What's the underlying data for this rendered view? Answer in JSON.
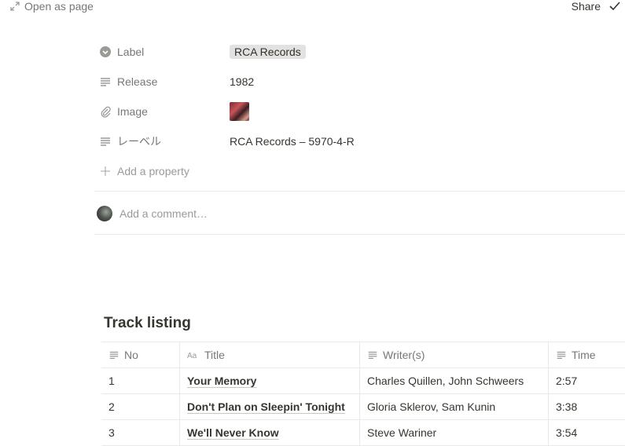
{
  "topbar": {
    "open_as_page": "Open as page",
    "share": "Share"
  },
  "properties": [
    {
      "icon": "select-icon",
      "key": "Label",
      "value": "RCA Records",
      "type": "tag"
    },
    {
      "icon": "text-icon",
      "key": "Release",
      "value": "1982",
      "type": "text"
    },
    {
      "icon": "attachment-icon",
      "key": "Image",
      "value": "",
      "type": "image"
    },
    {
      "icon": "text-icon",
      "key": "レーベル",
      "value": "RCA Records – 5970-4-R",
      "type": "text"
    }
  ],
  "add_property": "Add a property",
  "comment_placeholder": "Add a comment…",
  "section_title": "Track listing",
  "table": {
    "columns": [
      {
        "icon": "text-icon",
        "label": "No"
      },
      {
        "icon": "title-icon",
        "label": "Title"
      },
      {
        "icon": "text-icon",
        "label": "Writer(s)"
      },
      {
        "icon": "text-icon",
        "label": "Time"
      }
    ],
    "rows": [
      {
        "no": "1",
        "title": "Your Memory",
        "writers": "Charles Quillen, John Schweers",
        "time": "2:57"
      },
      {
        "no": "2",
        "title": "Don't Plan on Sleepin' Tonight",
        "writers": "Gloria Sklerov, Sam Kunin",
        "time": "3:38"
      },
      {
        "no": "3",
        "title": "We'll Never Know",
        "writers": "Steve Wariner",
        "time": "3:54"
      }
    ]
  }
}
